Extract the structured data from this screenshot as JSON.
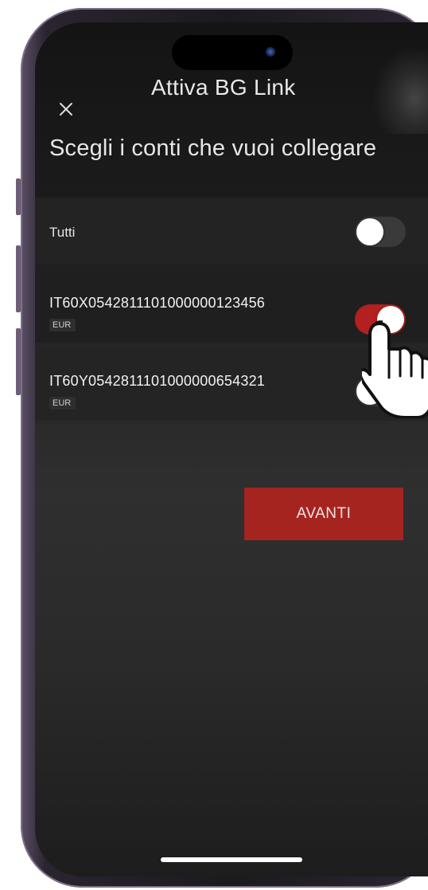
{
  "header": {
    "title": "Attiva BG Link",
    "close_icon": "close-icon"
  },
  "subtitle": "Scegli i conti che vuoi collegare",
  "select_all": {
    "label": "Tutti",
    "enabled": false
  },
  "accounts": [
    {
      "iban": "IT60X0542811101000000123456",
      "currency": "EUR",
      "enabled": true
    },
    {
      "iban": "IT60Y0542811101000000654321",
      "currency": "EUR",
      "enabled": false
    }
  ],
  "primary_button": {
    "label": "AVANTI"
  },
  "overlay": {
    "pointer_icon": "hand-pointer-icon"
  },
  "colors": {
    "accent": "#b3201f",
    "button": "#a62420",
    "background": "#1b1b1b",
    "text": "#e8e8e8"
  }
}
